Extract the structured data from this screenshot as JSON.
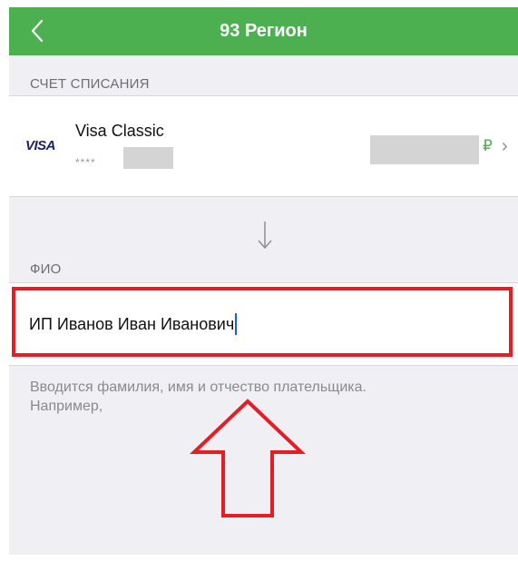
{
  "header": {
    "title": "93 Регион",
    "back_icon": "chevron-left-icon",
    "background": "#4caf50"
  },
  "debit_account": {
    "section_label": "СЧЕТ СПИСАНИЯ",
    "card_brand": "VISA",
    "card_name": "Visa Classic",
    "card_mask": "****",
    "currency_symbol": "₽",
    "chevron": "›"
  },
  "transfer_arrow_icon": "arrow-down-icon",
  "fio": {
    "section_label": "ФИО",
    "value": "ИП Иванов Иван Иванович",
    "hint_line1": "Вводится фамилия, имя и отчество плательщика.",
    "hint_line2": "Например,"
  },
  "annotation": {
    "highlight_color": "#e31e24",
    "pointer_icon": "arrow-up-outline-icon"
  }
}
